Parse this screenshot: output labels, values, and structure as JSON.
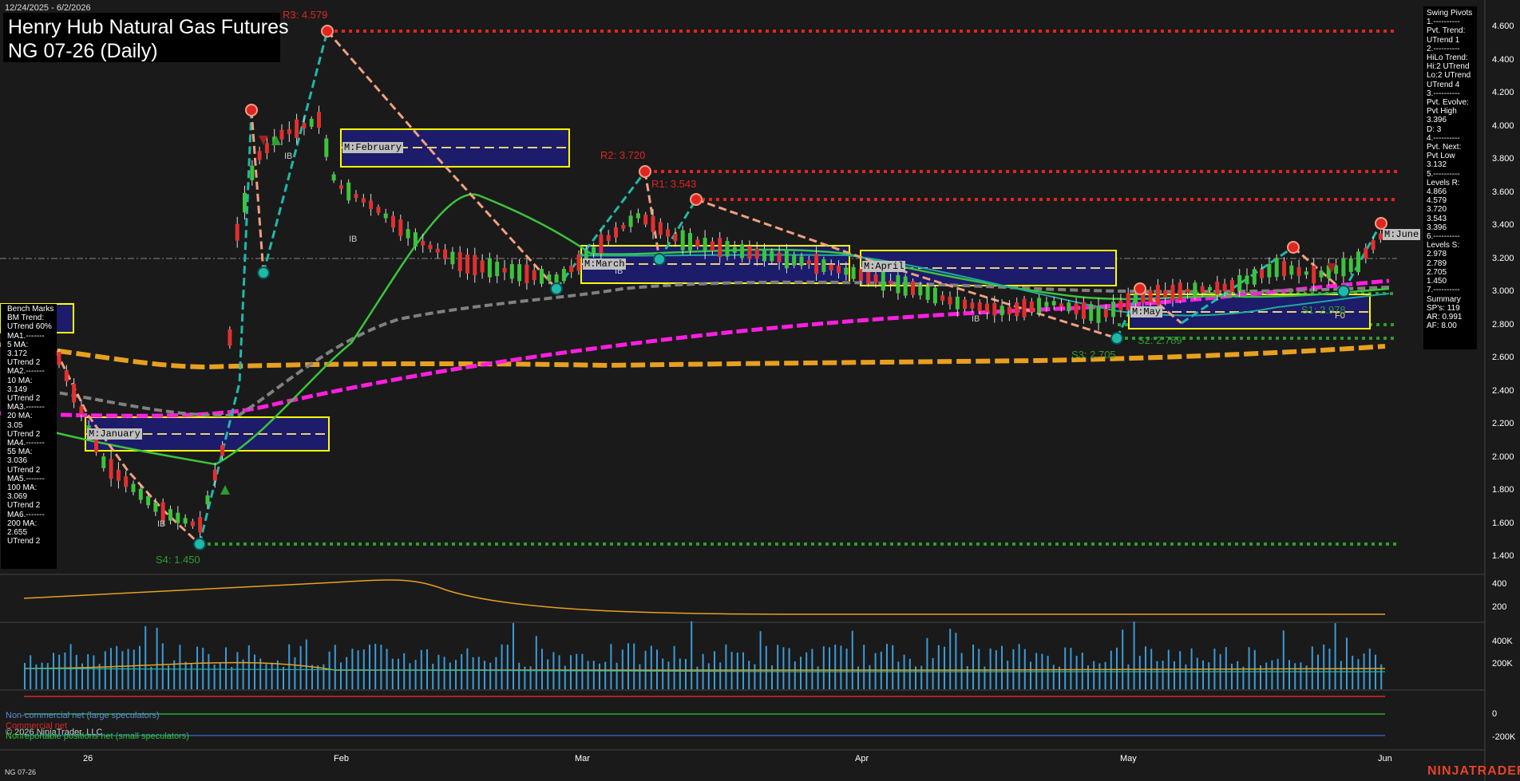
{
  "header": {
    "date_range": "12/24/2025 - 6/2/2026",
    "title": "Henry Hub Natural Gas Futures",
    "subtitle": "NG 07-26 (Daily)"
  },
  "levels": {
    "r3": "R3: 4.579",
    "r2": "R2: 3.720",
    "r1": "R1: 3.543",
    "s4": "S4: 1.450",
    "s3": "S3: 2.705",
    "s2": "S2: 2.789",
    "s1": "S1: 2.978",
    "f0": "F0"
  },
  "month_boxes": {
    "january": "M:January",
    "february": "M:February",
    "march": "M:March",
    "april": "M:April",
    "may": "M:May",
    "june": "M:June"
  },
  "ib_label": "IB",
  "bench": {
    "header": "Bench Marks",
    "lines": [
      "BM Trend:",
      "UTrend 60%",
      "MA1.-------",
      "5 MA:",
      "3.172",
      "UTrend 2",
      "MA2.-------",
      "10 MA:",
      "3.149",
      "UTrend 2",
      "MA3.-------",
      "20 MA:",
      "3.05",
      "UTrend 2",
      "MA4.-------",
      "55 MA:",
      "3.036",
      "UTrend 2",
      "MA5.-------",
      "100 MA:",
      "3.069",
      "UTrend 2",
      "MA6.-------",
      "200 MA:",
      "2.655",
      "UTrend 2"
    ]
  },
  "pivots": {
    "lines": [
      "Swing Pivots",
      "1.----------",
      "Pvt. Trend:",
      "UTrend 1",
      "2.----------",
      "HiLo Trend:",
      "Hi:2 UTrend",
      "Lo:2 UTrend",
      "UTrend 4",
      "3.----------",
      "Pvt. Evolve:",
      "Pvt High",
      "3.396",
      "D: 3",
      "4.----------",
      "Pvt. Next:",
      "Pvt Low",
      "3.132",
      "5.----------",
      "Levels R:",
      "4.866",
      "4.579",
      "3.720",
      "3.543",
      "3.396",
      "6.----------",
      "Levels S:",
      "2.978",
      "2.789",
      "2.705",
      "1.450",
      "7.----------",
      "Summary",
      "SP's: 119",
      "AR: 0.991",
      "AF: 8.00"
    ]
  },
  "price_axis": [
    "4.600",
    "4.400",
    "4.200",
    "4.000",
    "3.800",
    "3.600",
    "3.400",
    "3.200",
    "3.000",
    "2.800",
    "2.600",
    "2.400",
    "2.200",
    "2.000",
    "1.800",
    "1.600",
    "1.400"
  ],
  "panel2_axis": [
    "400",
    "200"
  ],
  "panel3_axis": [
    "400K",
    "200K"
  ],
  "panel4_axis": [
    "0",
    "-200K"
  ],
  "x_axis": [
    "26",
    "Feb",
    "Mar",
    "Apr",
    "May",
    "Jun"
  ],
  "legend": {
    "noncommercial": "Non-commercial net (large speculators)",
    "commercial": "Commercial net",
    "copyright": "© 2026 NinjaTrader, LLC",
    "nonreportable": "Nonreportable positions net (small speculators)"
  },
  "footer": {
    "instrument": "NG 07-26",
    "brand": "NINJATRADER"
  },
  "colors": {
    "background": "#1a1a1a",
    "resistance": "#e02424",
    "support": "#2e9c2e",
    "ma_magenta": "#ff1fe0",
    "ma_orange": "#e8a020",
    "ma_green": "#3cc43c",
    "ma_gray": "#808080",
    "swing_teal": "#20b8a8",
    "swing_salmon": "#f0a080",
    "month_box_fill": "#1c1c6a",
    "month_box_border": "#ffff00",
    "volume_bar": "#3a9bd8"
  }
}
